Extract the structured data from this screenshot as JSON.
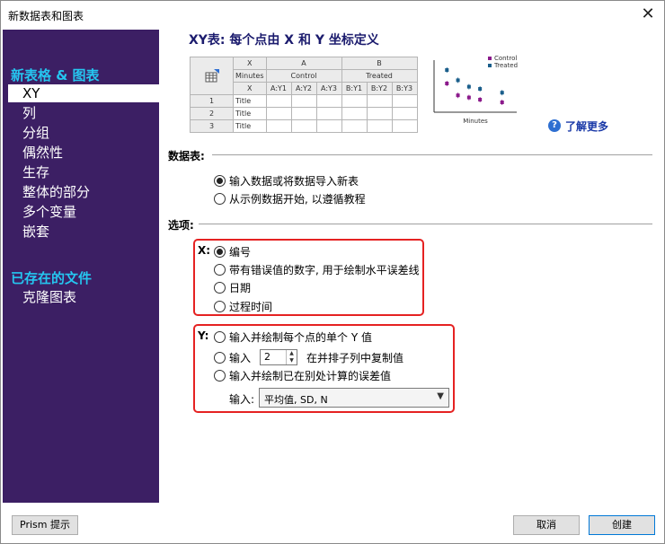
{
  "window": {
    "title": "新数据表和图表",
    "close_glyph": "✕"
  },
  "sidebar": {
    "section1": "新表格 & 图表",
    "items": [
      "XY",
      "列",
      "分组",
      "偶然性",
      "生存",
      "整体的部分",
      "多个变量",
      "嵌套"
    ],
    "section2": "已存在的文件",
    "items2": [
      "克隆图表"
    ]
  },
  "main": {
    "title": "XY表: 每个点由 X 和 Y 坐标定义"
  },
  "grid": {
    "row_hdr": {
      "c1": "X",
      "c2": "A",
      "c3": "B"
    },
    "row_sub": {
      "c1": "Minutes",
      "c2": "Control",
      "c3": "Treated"
    },
    "cols": [
      "X",
      "A:Y1",
      "A:Y2",
      "A:Y3",
      "B:Y1",
      "B:Y2",
      "B:Y3"
    ],
    "rows": [
      {
        "num": "1",
        "title": "Title"
      },
      {
        "num": "2",
        "title": "Title"
      },
      {
        "num": "3",
        "title": "Title"
      }
    ]
  },
  "chart_data": {
    "type": "scatter",
    "title": "",
    "xlabel": "Minutes",
    "ylabel": "",
    "legend_position": "top-right",
    "series": [
      {
        "name": "Control",
        "color": "#8b1a8b",
        "points": [
          [
            1,
            5
          ],
          [
            2,
            2.8
          ],
          [
            3,
            2.4
          ],
          [
            4,
            2.0
          ],
          [
            6,
            1.5
          ]
        ]
      },
      {
        "name": "Treated",
        "color": "#1a5e8b",
        "points": [
          [
            1,
            7.5
          ],
          [
            2,
            5.6
          ],
          [
            3,
            4.4
          ],
          [
            4,
            4.0
          ],
          [
            6,
            3.3
          ]
        ]
      }
    ]
  },
  "learn_more": "了解更多",
  "data_table": {
    "label": "数据表:",
    "options": [
      "输入数据或将数据导入新表",
      "从示例数据开始, 以遵循教程"
    ],
    "selected": 0
  },
  "options": {
    "label": "选项:"
  },
  "x_options": {
    "label": "X:",
    "items": [
      "编号",
      "带有错误值的数字, 用于绘制水平误差线",
      "日期",
      "过程时间"
    ],
    "selected": 0
  },
  "y_options": {
    "label": "Y:",
    "item1": "输入并绘制每个点的单个 Y 值",
    "item2_prefix": "输入",
    "replicates": "2",
    "item2_suffix": "在并排子列中复制值",
    "item3": "输入并绘制已在别处计算的误差值",
    "input_label": "输入:",
    "input_value": "平均值, SD, N"
  },
  "buttons": {
    "tips": "Prism 提示",
    "cancel": "取消",
    "create": "创建"
  },
  "colors": {
    "sidebar_bg": "#3c1f64",
    "sidebar_heading": "#25c6f0",
    "highlight_border": "#e52222",
    "link": "#1b3aa8"
  }
}
